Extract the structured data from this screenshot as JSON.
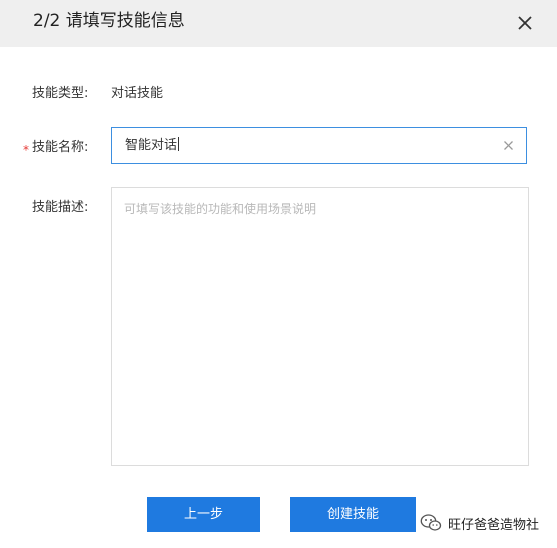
{
  "dialog": {
    "title": "2/2 请填写技能信息",
    "close_icon": "close-icon"
  },
  "form": {
    "type": {
      "label": "技能类型:",
      "value": "对话技能"
    },
    "name": {
      "required_mark": "*",
      "label": "技能名称:",
      "value": "智能对话",
      "clear_icon": "clear-icon"
    },
    "description": {
      "label": "技能描述:",
      "placeholder": "可填写该技能的功能和使用场景说明"
    }
  },
  "buttons": {
    "prev_label": "上一步",
    "create_label": "创建技能"
  },
  "watermark": {
    "text": "旺仔爸爸造物社",
    "icon": "wechat-icon"
  },
  "colors": {
    "primary": "#1f7ae0",
    "header_bg": "#efefef",
    "focus_border": "#3d8fe0",
    "required": "#e53935"
  }
}
